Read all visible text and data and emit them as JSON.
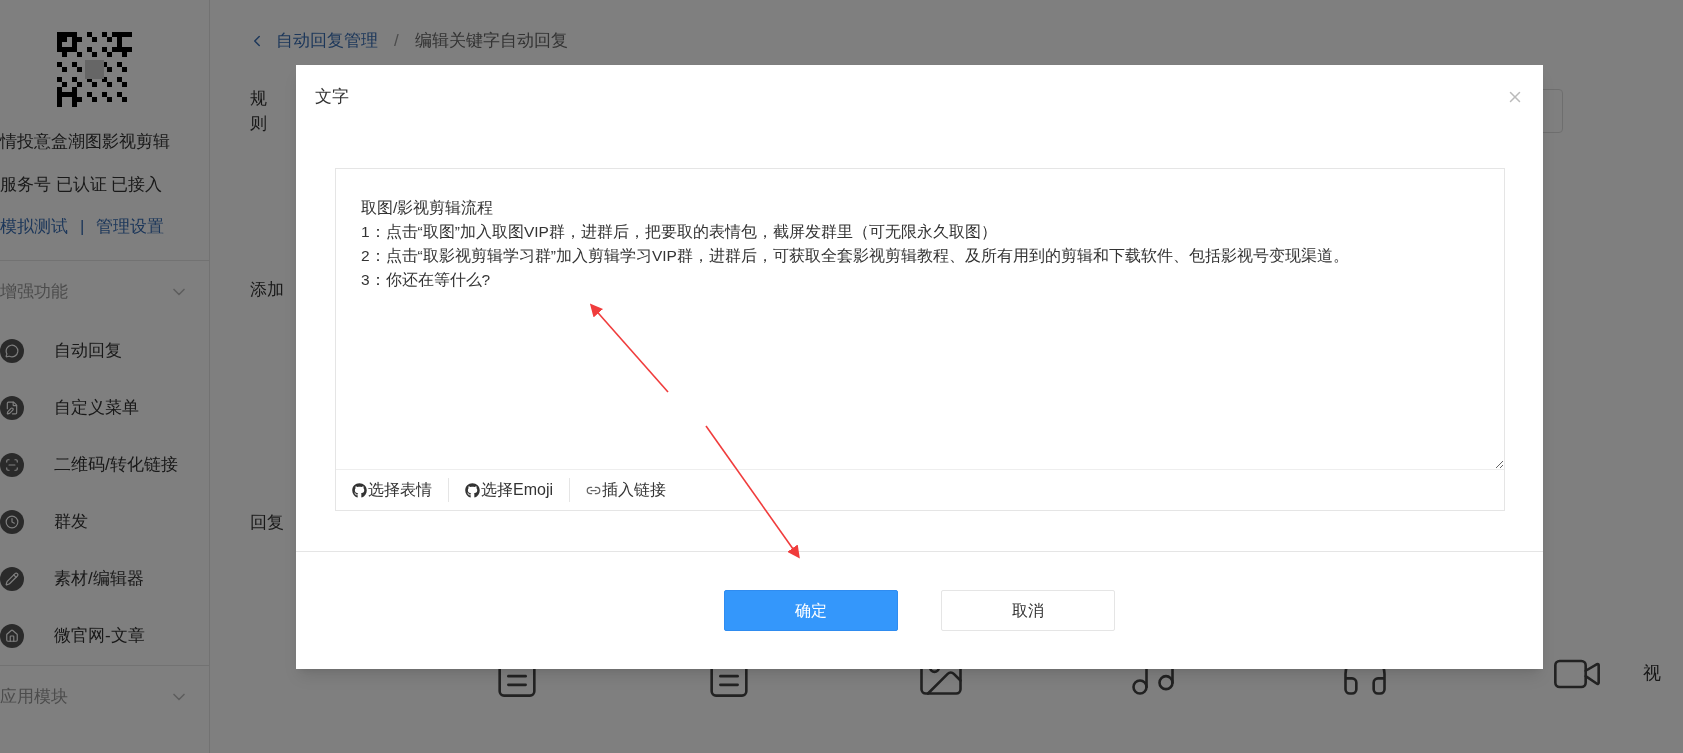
{
  "sidebar": {
    "account_name": "情投意盒潮图影视剪辑",
    "account_status": "服务号 已认证 已接入",
    "links": [
      "模拟测试",
      "管理设置"
    ],
    "link_separator": "|",
    "sections": [
      {
        "title": "增强功能",
        "items": [
          "自动回复",
          "自定义菜单",
          "二维码/转化链接",
          "群发",
          "素材/编辑器",
          "微官网-文章"
        ]
      },
      {
        "title": "应用模块"
      }
    ]
  },
  "breadcrumb": {
    "parent": "自动回复管理",
    "separator": "/",
    "current": "编辑关键字自动回复"
  },
  "form_labels": [
    "规则",
    "添加",
    "回复"
  ],
  "reply_type_label": "视",
  "dialog": {
    "title": "文字",
    "content": "取图/影视剪辑流程\n1：点击“取图”加入取图VIP群，进群后，把要取的表情包，截屏发群里（可无限永久取图）\n2：点击“取影视剪辑学习群”加入剪辑学习VIP群，进群后，可获取全套影视剪辑教程、及所有用到的剪辑和下载软件、包括影视号变现渠道。\n3：你还在等什么?",
    "toolbar": [
      "选择表情",
      "选择Emoji",
      "插入链接"
    ],
    "buttons": [
      {
        "label": "确定",
        "kind": "primary"
      },
      {
        "label": "取消",
        "kind": "default"
      }
    ]
  }
}
